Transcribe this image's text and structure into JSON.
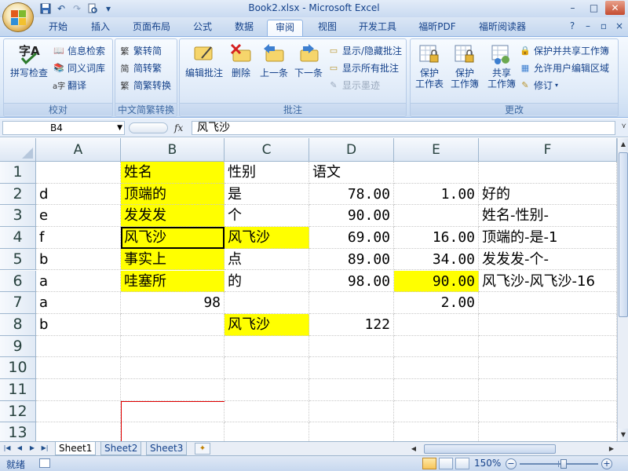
{
  "window": {
    "title": "Book2.xlsx - Microsoft Excel",
    "controls": [
      "–",
      "□",
      "✕"
    ]
  },
  "qat": [
    "save-icon",
    "undo-icon",
    "redo-icon",
    "print-preview-icon",
    "customize-icon"
  ],
  "tabs": [
    {
      "label": "开始"
    },
    {
      "label": "插入"
    },
    {
      "label": "页面布局"
    },
    {
      "label": "公式"
    },
    {
      "label": "数据"
    },
    {
      "label": "审阅",
      "active": true
    },
    {
      "label": "视图"
    },
    {
      "label": "开发工具"
    },
    {
      "label": "福昕PDF"
    },
    {
      "label": "福昕阅读器"
    }
  ],
  "ribbon": {
    "proofing": {
      "label": "校对",
      "spell": "拼写检查",
      "research": "信息检索",
      "thesaurus": "同义词库",
      "translate": "翻译"
    },
    "chinese": {
      "label": "中文简繁转换",
      "to_trad": "繁转简",
      "to_simp": "简转繁",
      "convert": "简繁转换"
    },
    "comments": {
      "label": "批注",
      "edit": "编辑批注",
      "delete": "删除",
      "prev": "上一条",
      "next": "下一条",
      "show_hide": "显示/隐藏批注",
      "show_all": "显示所有批注",
      "show_ink": "显示墨迹"
    },
    "changes": {
      "label": "更改",
      "protect_sheet": "保护\n工作表",
      "protect_book": "保护\n工作簿",
      "share_book": "共享\n工作簿",
      "protect_share": "保护并共享工作簿",
      "allow_edit": "允许用户编辑区域",
      "track": "修订"
    }
  },
  "formula_bar": {
    "name_box": "B4",
    "fx": "fx",
    "content": "风飞沙"
  },
  "columns": [
    "A",
    "B",
    "C",
    "D",
    "E",
    "F"
  ],
  "rows": [
    "1",
    "2",
    "3",
    "4",
    "5",
    "6",
    "7",
    "8",
    "9",
    "10",
    "11",
    "12",
    "13"
  ],
  "cells": {
    "B1": "姓名",
    "C1": "性别",
    "D1": "语文",
    "A2": "d",
    "B2": "顶端的",
    "C2": "是",
    "D2": "78.00",
    "E2": "1.00",
    "F2": "好的",
    "A3": "e",
    "B3": "发发发",
    "C3": "个",
    "D3": "90.00",
    "F3": "姓名-性别-",
    "A4": "f",
    "B4": "风飞沙",
    "C4": "风飞沙",
    "D4": "69.00",
    "E4": "16.00",
    "F4": "顶端的-是-1",
    "A5": "b",
    "B5": "事实上",
    "C5": "点",
    "D5": "89.00",
    "E5": "34.00",
    "F5": "发发发-个-",
    "A6": "a",
    "B6": "哇塞所",
    "C6": "的",
    "D6": "98.00",
    "E6": "90.00",
    "F6": "风飞沙-风飞沙-16",
    "A7": "a",
    "B7": "98",
    "E7": "2.00",
    "A8": "b",
    "C8": "风飞沙",
    "D8": "122"
  },
  "sheets": [
    "Sheet1",
    "Sheet2",
    "Sheet3"
  ],
  "status": {
    "mode": "就绪",
    "zoom": "150%"
  }
}
